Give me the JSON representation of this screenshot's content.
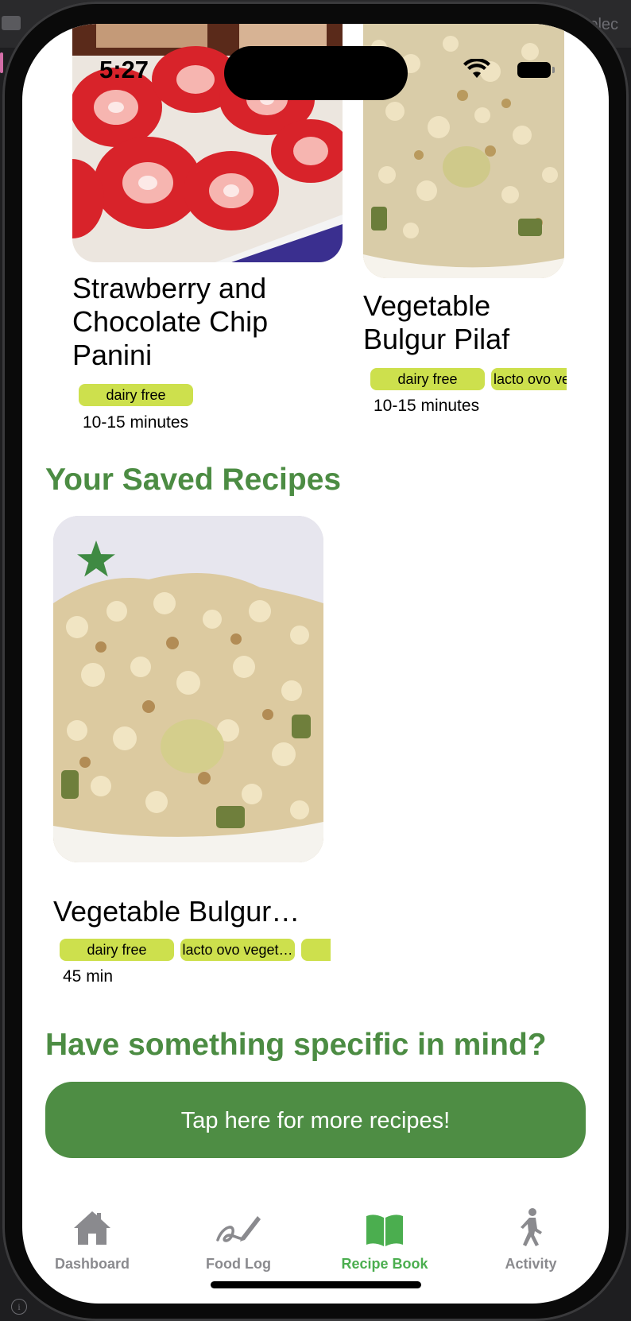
{
  "status_bar": {
    "time": "5:27"
  },
  "host": {
    "select_label": "Selec",
    "info_glyph": "i"
  },
  "carousel": [
    {
      "title": "Strawberry and Chocolate Chip Panini",
      "tags": [
        "dairy free"
      ],
      "time": "10-15 minutes"
    },
    {
      "title": "Vegetable Bulgur Pilaf",
      "tags": [
        "dairy free",
        "lacto ovo ve"
      ],
      "time": "10-15 minutes"
    }
  ],
  "saved_section": {
    "title": "Your Saved Recipes",
    "items": [
      {
        "title": "Vegetable Bulgur…",
        "tags": [
          "dairy free",
          "lacto ovo veget…",
          ""
        ],
        "time": "45 min",
        "starred": true
      }
    ]
  },
  "search_section": {
    "title": "Have something specific in mind?",
    "button_label": "Tap here for more recipes!"
  },
  "tabbar": {
    "tabs": [
      {
        "label": "Dashboard",
        "icon": "house-icon",
        "active": false
      },
      {
        "label": "Food Log",
        "icon": "signature-icon",
        "active": false
      },
      {
        "label": "Recipe Book",
        "icon": "book-icon",
        "active": true
      },
      {
        "label": "Activity",
        "icon": "figure-walk-icon",
        "active": false
      }
    ]
  },
  "colors": {
    "accent_green": "#4c8c43",
    "button_green": "#4e8d44",
    "tag_yellow_green": "#cde04d",
    "tab_active": "#4bae4f",
    "tab_inactive": "#8a8a8e"
  }
}
